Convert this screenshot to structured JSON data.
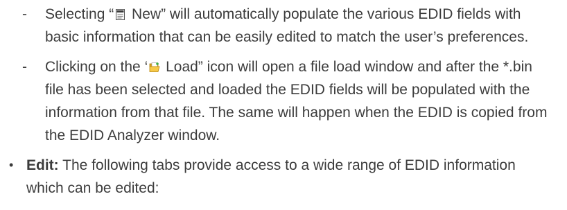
{
  "items": [
    {
      "marker": "-",
      "before_icon": "Selecting “",
      "icon": "new-document-icon",
      "after_icon": " New” will automatically populate the various EDID fields with basic information that can be easily edited to match the user’s preferences."
    },
    {
      "marker": "-",
      "before_icon": " Clicking on the ‘",
      "icon": "folder-open-icon",
      "after_icon": " Load” icon will open a file load window and after the *.bin file has been selected and loaded the EDID fields will be populated with the information from that file. The same will happen when the EDID is copied from the EDID Analyzer window."
    }
  ],
  "bullet": {
    "marker": "•",
    "bold_label": "Edit:",
    "text": " The following tabs provide access to a wide range of EDID information which can be edited:"
  }
}
